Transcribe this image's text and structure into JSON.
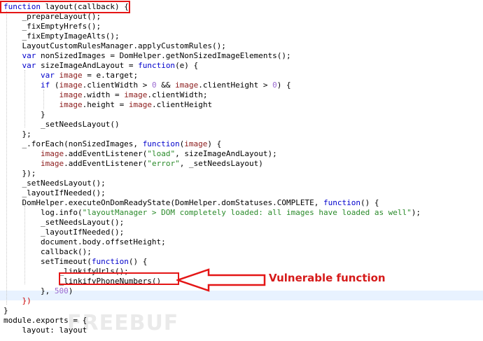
{
  "editor": {
    "lines": [
      "function layout(callback) {",
      "    _prepareLayout();",
      "    _fixEmptyHrefs();",
      "    _fixEmptyImageAlts();",
      "    LayoutCustomRulesManager.applyCustomRules();",
      "    var nonSizedImages = DomHelper.getNonSizedImageElements();",
      "    var sizeImageAndLayout = function(e) {",
      "        var image = e.target;",
      "        if (image.clientWidth > 0 && image.clientHeight > 0) {",
      "            image.width = image.clientWidth;",
      "            image.height = image.clientHeight",
      "        }",
      "        _setNeedsLayout()",
      "    };",
      "    _.forEach(nonSizedImages, function(image) {",
      "        image.addEventListener(\"load\", sizeImageAndLayout);",
      "        image.addEventListener(\"error\", _setNeedsLayout)",
      "    });",
      "    _setNeedsLayout();",
      "    _layoutIfNeeded();",
      "    DomHelper.executeOnDomReadyState(DomHelper.domStatuses.COMPLETE, function() {",
      "        log.info(\"layoutManager > DOM completely loaded: all images have loaded as well\");",
      "        _setNeedsLayout();",
      "        _layoutIfNeeded();",
      "        document.body.offsetHeight;",
      "        callback();",
      "        setTimeout(function() {",
      "            _linkifyUrls();",
      "            _linkifyPhoneNumbers()",
      "        }, 500)",
      "    })",
      "}",
      "module.exports = {",
      "    layout: layout"
    ]
  },
  "annotation": {
    "label": "Vulnerable function",
    "color": "#d61a1a"
  },
  "watermark": {
    "text": "FREEBUF"
  }
}
